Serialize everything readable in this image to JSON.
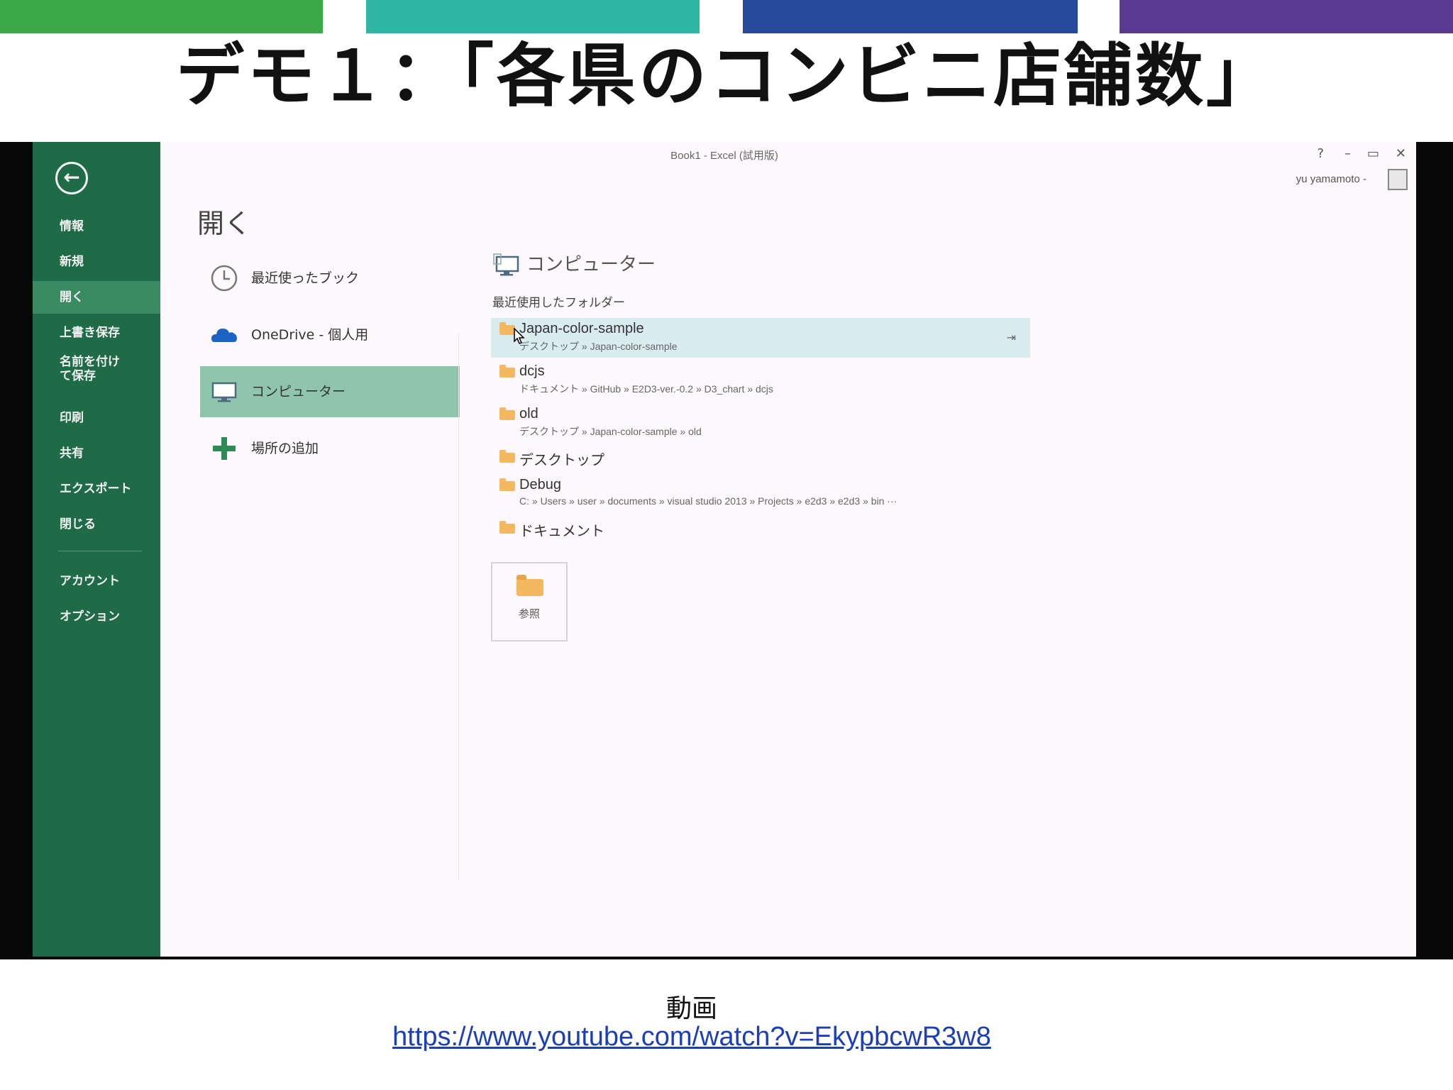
{
  "slide": {
    "title": "デモ１：「各県のコンビニ店舗数」",
    "bar_colors": [
      "#3aaa48",
      "#30b6a4",
      "#27499c",
      "#5a3a90"
    ]
  },
  "window": {
    "title": "Book1 - Excel (試用版)",
    "controls": {
      "help": "?",
      "minimize": "–",
      "restore": "▭",
      "close": "✕"
    },
    "user_name": "yu yamamoto -"
  },
  "sidebar": {
    "back_icon": "back-arrow-icon",
    "items": [
      {
        "label": "情報"
      },
      {
        "label": "新規"
      },
      {
        "label": "開く"
      },
      {
        "label": "上書き保存"
      },
      {
        "label": "名前を付けて保存"
      },
      {
        "label": "印刷"
      },
      {
        "label": "共有"
      },
      {
        "label": "エクスポート"
      },
      {
        "label": "閉じる"
      },
      {
        "label": "アカウント"
      },
      {
        "label": "オプション"
      }
    ],
    "active_index": 2
  },
  "open_page": {
    "heading": "開く",
    "places": [
      {
        "label": "最近使ったブック",
        "icon": "clock-icon"
      },
      {
        "label": "OneDrive - 個人用",
        "icon": "cloud-icon"
      },
      {
        "label": "コンピューター",
        "icon": "computer-icon"
      },
      {
        "label": "場所の追加",
        "icon": "plus-icon"
      }
    ],
    "selected_place": 2
  },
  "computer_pane": {
    "title": "コンピューター",
    "recent_label": "最近使用したフォルダー",
    "folders": [
      {
        "name": "Japan-color-sample",
        "path": "デスクトップ » Japan-color-sample"
      },
      {
        "name": "dcjs",
        "path": "ドキュメント » GitHub » E2D3-ver.-0.2 » D3_chart » dcjs"
      },
      {
        "name": "old",
        "path": "デスクトップ » Japan-color-sample » old"
      },
      {
        "name": "デスクトップ",
        "path": ""
      },
      {
        "name": "Debug",
        "path": "C: » Users » user » documents » visual studio 2013 » Projects » e2d3 » e2d3 » bin ···"
      },
      {
        "name": "ドキュメント",
        "path": ""
      }
    ],
    "browse_label": "参照"
  },
  "footer": {
    "label": "動画",
    "link": "https://www.youtube.com/watch?v=EkypbcwR3w8"
  }
}
